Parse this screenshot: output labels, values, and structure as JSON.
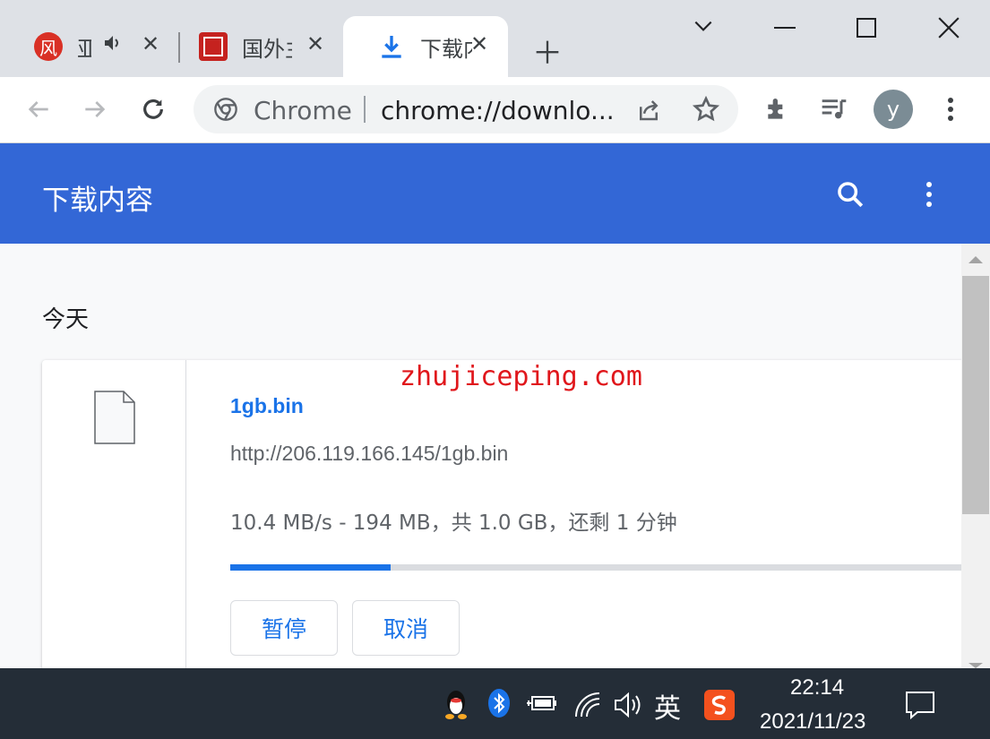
{
  "tabs": [
    {
      "title": "风 亚",
      "favicon_char": "风",
      "favicon_color": "#d93025",
      "has_audio": true,
      "active": false
    },
    {
      "title": "国外主",
      "favicon_char": "",
      "favicon_color": "#c5221f",
      "active": false
    },
    {
      "title": "下载内",
      "favicon_icon": "download-icon",
      "active": true
    }
  ],
  "tab_labels": {
    "tab1": "亚",
    "tab2": "国外主",
    "tab3": "下载内"
  },
  "omnibox": {
    "site_label": "Chrome",
    "url": "chrome://downlo..."
  },
  "profile_initial": "y",
  "header": {
    "title": "下载内容"
  },
  "section": {
    "title": "今天"
  },
  "download": {
    "file_name": "1gb.bin",
    "url": "http://206.119.166.145/1gb.bin",
    "status": "10.4 MB/s - 194 MB，共 1.0 GB，还剩 1 分钟",
    "progress": 0.216,
    "pause_label": "暂停",
    "cancel_label": "取消"
  },
  "watermark": "zhujiceping.com",
  "taskbar": {
    "ime": "英",
    "time": "22:14",
    "date": "2021/11/23"
  },
  "colors": {
    "accent": "#3367d6",
    "link": "#1a73e8",
    "taskbar": "#242d37"
  }
}
